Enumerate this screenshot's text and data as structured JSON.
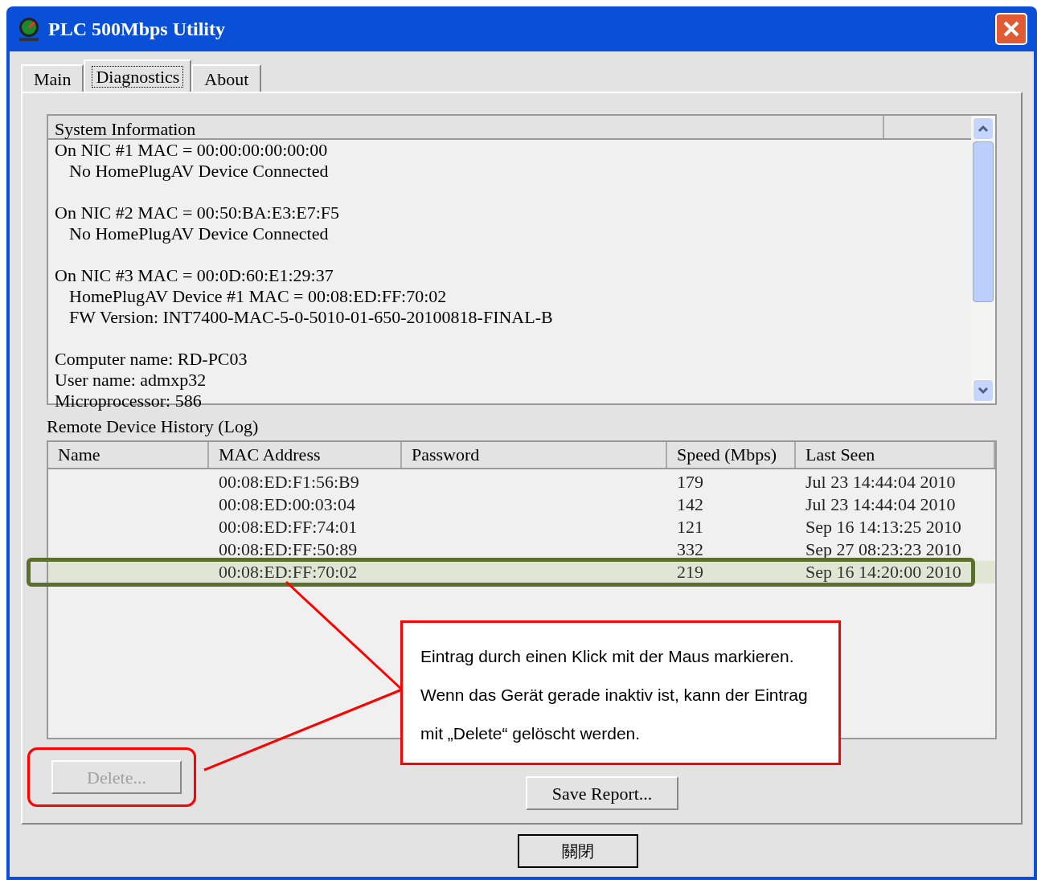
{
  "window": {
    "title": "PLC 500Mbps Utility"
  },
  "tabs": [
    {
      "label": "Main",
      "selected": false
    },
    {
      "label": "Diagnostics",
      "selected": true
    },
    {
      "label": "About",
      "selected": false
    }
  ],
  "system_information": {
    "header": "System Information",
    "groups": [
      {
        "lines": [
          {
            "text": "On NIC #1 MAC = 00:00:00:00:00:00",
            "indented": false
          },
          {
            "text": "No HomePlugAV Device Connected",
            "indented": true
          }
        ]
      },
      {
        "lines": [
          {
            "text": "On NIC #2 MAC = 00:50:BA:E3:E7:F5",
            "indented": false
          },
          {
            "text": "No HomePlugAV Device Connected",
            "indented": true
          }
        ]
      },
      {
        "lines": [
          {
            "text": "On NIC #3 MAC = 00:0D:60:E1:29:37",
            "indented": false
          },
          {
            "text": "HomePlugAV Device #1 MAC = 00:08:ED:FF:70:02",
            "indented": true
          },
          {
            "text": "FW Version: INT7400-MAC-5-0-5010-01-650-20100818-FINAL-B",
            "indented": true
          }
        ]
      },
      {
        "lines": [
          {
            "text": "Computer name: RD-PC03",
            "indented": false
          },
          {
            "text": "User name: admxp32",
            "indented": false
          },
          {
            "text": "Microprocessor: 586",
            "indented": false
          }
        ]
      }
    ]
  },
  "log": {
    "label": "Remote Device History (Log)",
    "columns": [
      "Name",
      "MAC Address",
      "Password",
      "Speed (Mbps)",
      "Last Seen"
    ],
    "rows": [
      {
        "mac": "00:08:ED:F1:56:B9",
        "speed": "179",
        "last_seen": "Jul 23 14:44:04 2010",
        "highlighted": false
      },
      {
        "mac": "00:08:ED:00:03:04",
        "speed": "142",
        "last_seen": "Jul 23 14:44:04 2010",
        "highlighted": false
      },
      {
        "mac": "00:08:ED:FF:74:01",
        "speed": "121",
        "last_seen": "Sep 16 14:13:25 2010",
        "highlighted": false
      },
      {
        "mac": "00:08:ED:FF:50:89",
        "speed": "332",
        "last_seen": "Sep 27 08:23:23 2010",
        "highlighted": false
      },
      {
        "mac": "00:08:ED:FF:70:02",
        "speed": "219",
        "last_seen": "Sep 16 14:20:00 2010",
        "highlighted": true
      }
    ]
  },
  "buttons": {
    "delete": {
      "label": "Delete...",
      "disabled": true
    },
    "save_report": {
      "label": "Save Report..."
    },
    "close": {
      "label": "關閉"
    }
  },
  "callout": {
    "text": "Eintrag durch einen Klick mit der Maus markieren. Wenn das Gerät gerade inaktiv ist, kann der Eintrag mit „Delete“ gelöscht werden."
  }
}
